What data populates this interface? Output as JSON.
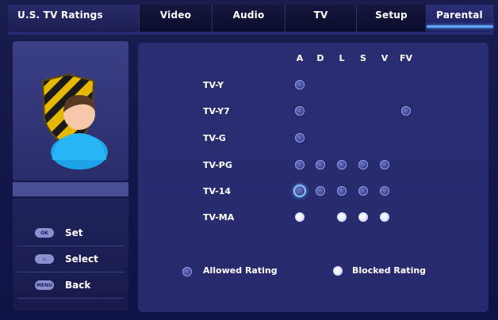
{
  "tabs": [
    "U.S. TV Ratings",
    "Video",
    "Audio",
    "TV",
    "Setup",
    "Parental"
  ],
  "active_tab": "Parental",
  "columns": [
    "A",
    "D",
    "L",
    "S",
    "V",
    "FV"
  ],
  "rows": [
    {
      "label": "TV-Y",
      "cells": [
        "allowed",
        null,
        null,
        null,
        null,
        null
      ]
    },
    {
      "label": "TV-Y7",
      "cells": [
        "allowed",
        null,
        null,
        null,
        null,
        "allowed"
      ]
    },
    {
      "label": "TV-G",
      "cells": [
        "allowed",
        null,
        null,
        null,
        null,
        null
      ]
    },
    {
      "label": "TV-PG",
      "cells": [
        "allowed",
        "allowed",
        "allowed",
        "allowed",
        "allowed",
        null
      ]
    },
    {
      "label": "TV-14",
      "cells": [
        "selected",
        "allowed",
        "allowed",
        "allowed",
        "allowed",
        null
      ]
    },
    {
      "label": "TV-MA",
      "cells": [
        "blocked",
        null,
        "blocked",
        "blocked",
        "blocked",
        null
      ]
    }
  ],
  "legend": {
    "allowed": "Allowed Rating",
    "blocked": "Blocked Rating"
  },
  "hints": [
    {
      "key": "OK",
      "label": "Set"
    },
    {
      "key": "◇",
      "label": "Select"
    },
    {
      "key": "MENU",
      "label": "Back"
    }
  ],
  "icon": "parental-shield-user-icon",
  "colors": {
    "accent": "#5aa8ff",
    "panel": "#2a2d72"
  }
}
